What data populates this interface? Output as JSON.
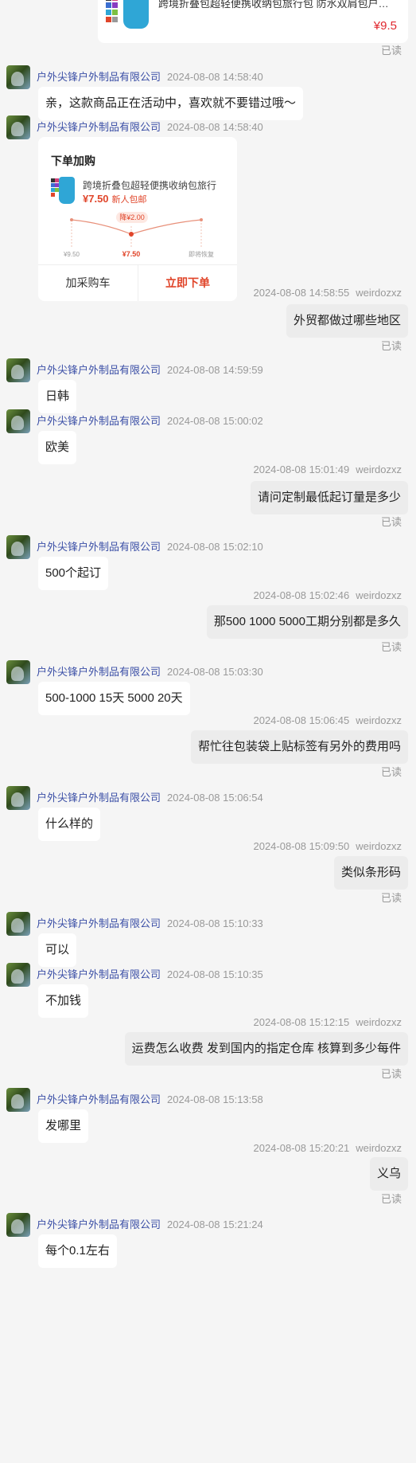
{
  "product_card": {
    "title": "跨境折叠包超轻便携收纳包旅行包 防水双肩包户外运…",
    "price": "¥9.5"
  },
  "read_label": "已读",
  "order_card": {
    "title": "下单加购",
    "product_name": "跨境折叠包超轻便携收纳包旅行",
    "price": "¥7.50",
    "price_tag": "新人包邮",
    "drop_badge": "降¥2.00",
    "point_left": "¥9.50",
    "point_mid": "¥7.50",
    "point_right": "即将恢复",
    "cart_button": "加采购车",
    "buy_button": "立即下单"
  },
  "messages": [
    {
      "dir": "in",
      "sender": "户外尖锋户外制品有限公司",
      "time": "2024-08-08 14:58:40",
      "text": "亲，这款商品正在活动中，喜欢就不要错过哦～"
    },
    {
      "dir": "in",
      "sender": "户外尖锋户外制品有限公司",
      "time": "2024-08-08 14:58:40",
      "card": true
    },
    {
      "dir": "out",
      "sender": "weirdozxz",
      "time": "2024-08-08 14:58:55",
      "text": "外贸都做过哪些地区"
    },
    {
      "dir": "in",
      "sender": "户外尖锋户外制品有限公司",
      "time": "2024-08-08 14:59:59",
      "text": "日韩"
    },
    {
      "dir": "in",
      "sender": "户外尖锋户外制品有限公司",
      "time": "2024-08-08 15:00:02",
      "text": "欧美"
    },
    {
      "dir": "out",
      "sender": "weirdozxz",
      "time": "2024-08-08 15:01:49",
      "text": "请问定制最低起订量是多少"
    },
    {
      "dir": "in",
      "sender": "户外尖锋户外制品有限公司",
      "time": "2024-08-08 15:02:10",
      "text": "500个起订"
    },
    {
      "dir": "out",
      "sender": "weirdozxz",
      "time": "2024-08-08 15:02:46",
      "text": "那500 1000 5000工期分别都是多久"
    },
    {
      "dir": "in",
      "sender": "户外尖锋户外制品有限公司",
      "time": "2024-08-08 15:03:30",
      "text": "500-1000 15天  5000  20天"
    },
    {
      "dir": "out",
      "sender": "weirdozxz",
      "time": "2024-08-08 15:06:45",
      "text": "帮忙往包装袋上贴标签有另外的费用吗"
    },
    {
      "dir": "in",
      "sender": "户外尖锋户外制品有限公司",
      "time": "2024-08-08 15:06:54",
      "text": "什么样的"
    },
    {
      "dir": "out",
      "sender": "weirdozxz",
      "time": "2024-08-08 15:09:50",
      "text": "类似条形码"
    },
    {
      "dir": "in",
      "sender": "户外尖锋户外制品有限公司",
      "time": "2024-08-08 15:10:33",
      "text": "可以"
    },
    {
      "dir": "in",
      "sender": "户外尖锋户外制品有限公司",
      "time": "2024-08-08 15:10:35",
      "text": "不加钱"
    },
    {
      "dir": "out",
      "sender": "weirdozxz",
      "time": "2024-08-08 15:12:15",
      "text": "运费怎么收费 发到国内的指定仓库 核算到多少每件"
    },
    {
      "dir": "in",
      "sender": "户外尖锋户外制品有限公司",
      "time": "2024-08-08 15:13:58",
      "text": "发哪里"
    },
    {
      "dir": "out",
      "sender": "weirdozxz",
      "time": "2024-08-08 15:20:21",
      "text": "义乌"
    },
    {
      "dir": "in",
      "sender": "户外尖锋户外制品有限公司",
      "time": "2024-08-08 15:21:24",
      "text": "每个0.1左右"
    }
  ]
}
